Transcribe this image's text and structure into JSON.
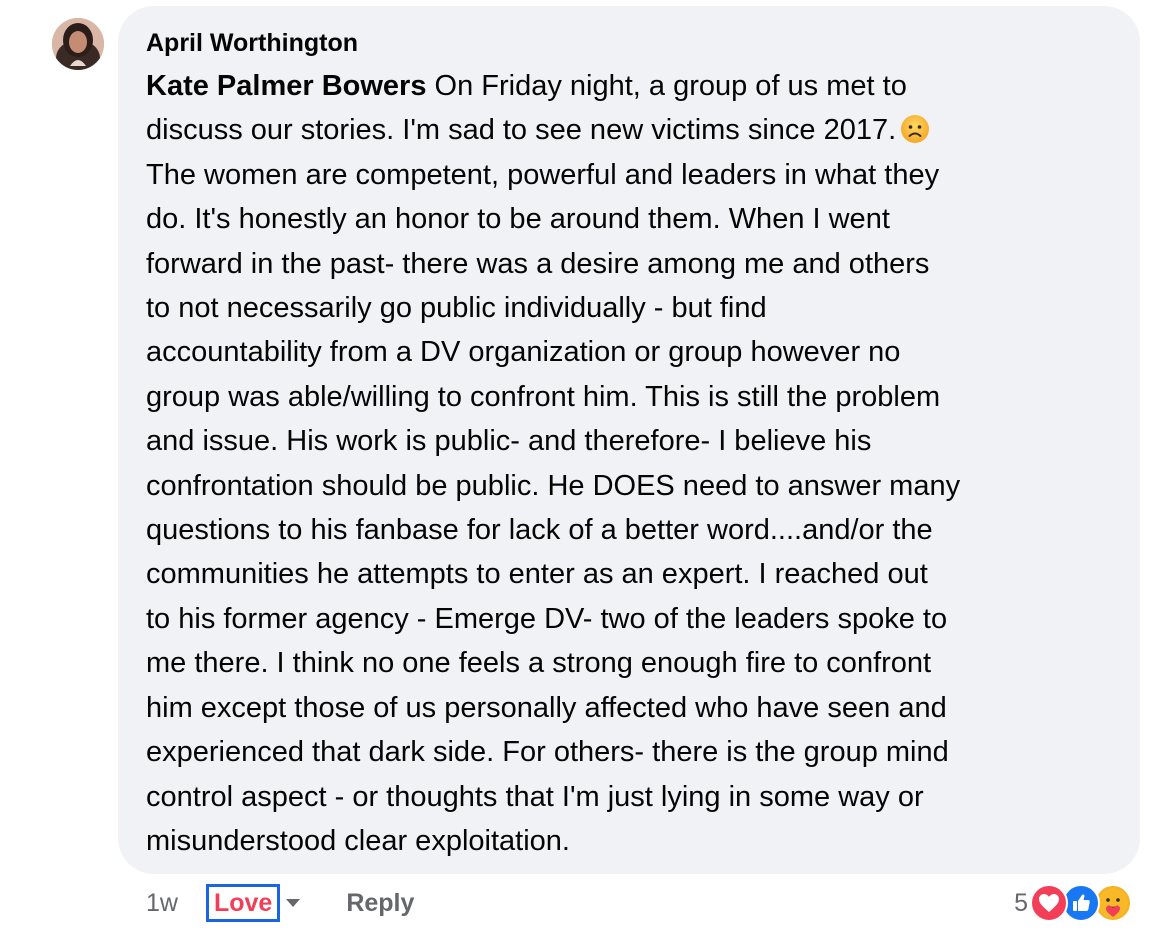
{
  "comment": {
    "author": "April Worthington",
    "tagged_name": "Kate Palmer Bowers",
    "lines": [
      " On Friday night, a group of us met to",
      "discuss our stories. I'm sad to see new victims since 2017.",
      "The women are competent, powerful and leaders in what they",
      "do. It's honestly an honor to be around them. When I went",
      "forward in the past- there was a desire among me and others",
      "to not necessarily go public individually - but find",
      "accountability from a DV organization or group however no",
      "group was able/willing to confront him. This is still the problem",
      "and issue. His work is public- and therefore- I believe his",
      "confrontation should be public. He DOES need to answer many",
      "questions to his fanbase for lack of a better word....and/or the",
      "communities he attempts to enter as an expert. I reached out",
      "to his former agency - Emerge DV- two of the leaders spoke to",
      "me there. I think no one feels a strong enough fire to confront",
      "him except those of us personally affected who have seen and",
      "experienced that dark side. For others- there is the group mind",
      "control aspect - or thoughts that I'm just lying in some way or",
      "misunderstood clear exploitation."
    ],
    "inline_emoji": "sad-face-emoji"
  },
  "actions": {
    "time": "1w",
    "love_label": "Love",
    "reply_label": "Reply"
  },
  "reactions": {
    "count": "5",
    "icons": [
      "love-reaction-icon",
      "like-reaction-icon",
      "care-reaction-icon"
    ]
  },
  "colors": {
    "bubble_bg": "#f0f2f5",
    "love": "#f33e58",
    "like": "#1877f2",
    "selection_outline": "#1a66e0",
    "muted_text": "#65676b"
  }
}
